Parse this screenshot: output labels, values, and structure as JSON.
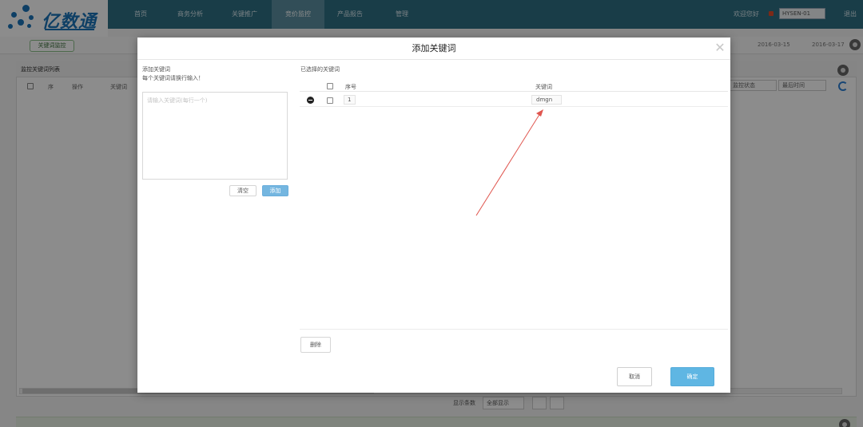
{
  "nav": {
    "brand": "亿数通",
    "items": [
      "首页",
      "商务分析",
      "关键推广",
      "竞价监控",
      "产品报告",
      "管理"
    ],
    "active_index": 3,
    "right_text": "欢迎您好",
    "account": "HYSEN-01",
    "logout": "退出"
  },
  "background": {
    "tab_label": "关键词监控",
    "date_from": "2016-03-15",
    "date_to": "2016-03-17",
    "panel_title": "监控关键词列表",
    "columns": [
      "序",
      "操作",
      "关键词"
    ],
    "right_columns": [
      "监控状态",
      "最后时间"
    ],
    "pager": {
      "per_page_label": "显示条数",
      "per_page_value": "全部显示"
    }
  },
  "modal": {
    "title": "添加关键词",
    "close_icon": "close-icon",
    "left_label": "添加关键词",
    "left_hint": "每个关键词请换行输入！",
    "textarea_placeholder": "请输入关键词(每行一个)",
    "clear_label": "清空",
    "add_label": "添加",
    "right_title": "已选择的关键词",
    "table": {
      "headers": [
        "序号",
        "关键词"
      ],
      "rows": [
        {
          "index": "1",
          "keyword": "dmgn"
        }
      ]
    },
    "delete_label": "删除",
    "cancel_label": "取消",
    "ok_label": "确定"
  },
  "colors": {
    "topnav": "#2f6f83",
    "brand": "#1b74b8",
    "primary_button": "#5fb6e3",
    "annotation_arrow": "#e0564f"
  }
}
